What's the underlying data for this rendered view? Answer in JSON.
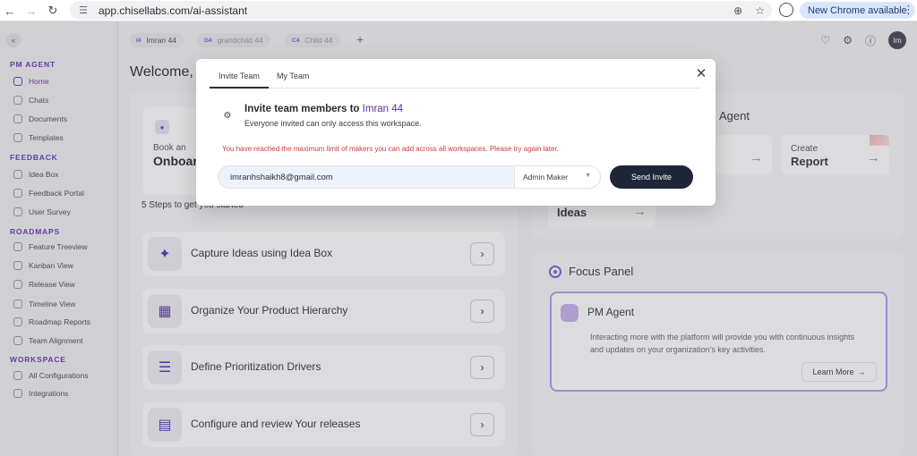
{
  "browser": {
    "url": "app.chisellabs.com/ai-assistant",
    "update_label": "New Chrome available"
  },
  "sidebar": {
    "sections": [
      {
        "title": "PM AGENT",
        "items": [
          "Home",
          "Chats",
          "Documents",
          "Templates"
        ]
      },
      {
        "title": "FEEDBACK",
        "items": [
          "Idea Box",
          "Feedback Portal",
          "User Survey"
        ]
      },
      {
        "title": "ROADMAPS",
        "items": [
          "Feature Treeview",
          "Kanban View",
          "Release View",
          "Timeline View",
          "Roadmap Reports",
          "Team Alignment"
        ]
      },
      {
        "title": "WORKSPACE",
        "items": [
          "All Configurations",
          "Integrations"
        ]
      }
    ]
  },
  "workspace_tabs": [
    {
      "badge": "I4",
      "label": "Imran 44"
    },
    {
      "badge": "G4",
      "label": "grandchild 44"
    },
    {
      "badge": "C4",
      "label": "Child 44"
    }
  ],
  "header": {
    "avatar_initials": "Im"
  },
  "main": {
    "welcome": "Welcome,",
    "onboard_line1": "Book an",
    "onboard_line2": "Onboar",
    "steps_title": "5 Steps to get you started",
    "steps": [
      "Capture Ideas using Idea Box",
      "Organize Your Product Hierarchy",
      "Define Prioritization Drivers",
      "Configure and review Your releases"
    ],
    "agent_title": "Agent",
    "create_line1": "Create",
    "create_line2": "Report",
    "ideas_label": "Ideas",
    "focus_title": "Focus Panel",
    "pm_title": "PM Agent",
    "pm_desc": "Interacting more with the platform will provide you with continuous insights and updates on your organization's key activities.",
    "learn_more": "Learn More"
  },
  "modal": {
    "tabs": [
      "Invite Team",
      "My Team"
    ],
    "title_prefix": "Invite team members to",
    "workspace_name": "Imran 44",
    "subtitle": "Everyone invited can only access this workspace.",
    "limit_message": "You have reached the maximum limit of makers you can add across all workspaces. Please try again later.",
    "email_value": "imranhshaikh8@gmail.com",
    "role_selected": "Admin Maker",
    "send_label": "Send Invite"
  },
  "colors": {
    "accent": "#6a3fb8",
    "error": "#d83a3a",
    "send_button": "#1e2638",
    "pm_card_border": "#b99be8"
  }
}
